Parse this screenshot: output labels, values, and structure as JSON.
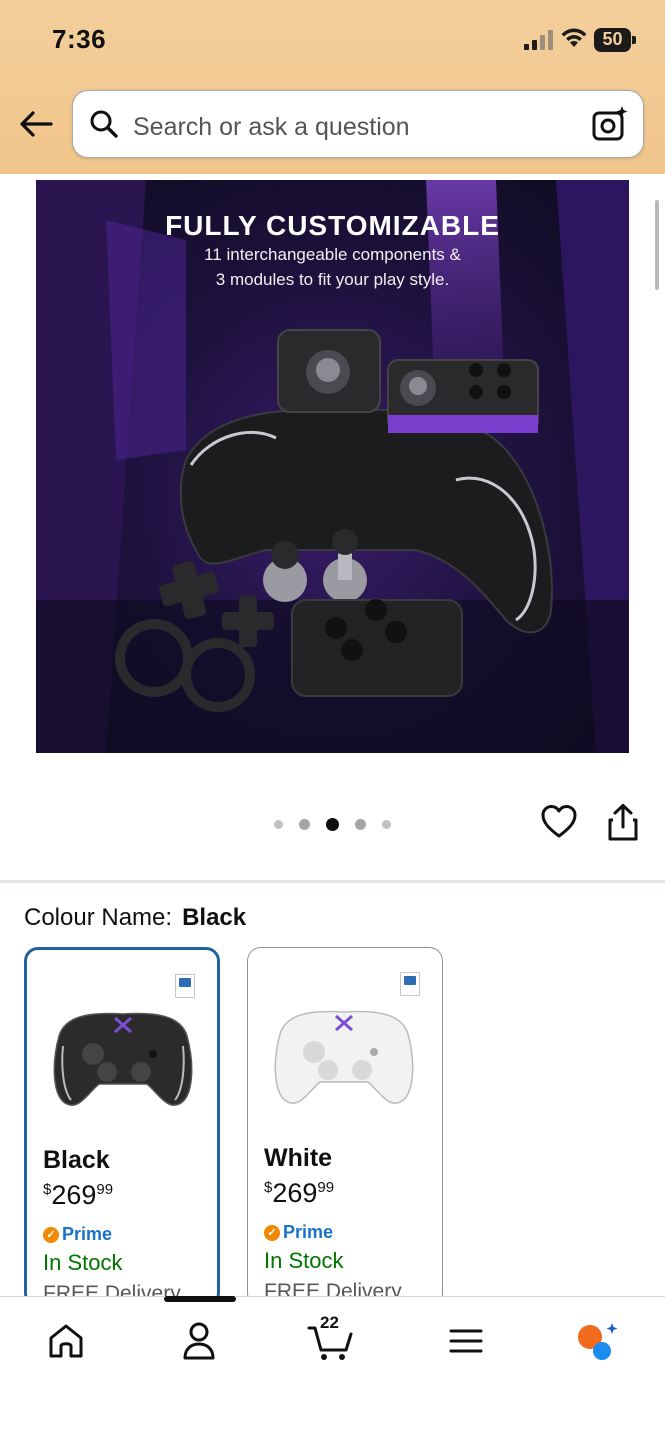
{
  "status_bar": {
    "time": "7:36",
    "battery": "50"
  },
  "search": {
    "placeholder": "Search or ask a question"
  },
  "hero": {
    "title": "FULLY CUSTOMIZABLE",
    "subtitle_line1": "11 interchangeable components &",
    "subtitle_line2": "3 modules to fit your play style.",
    "image_index": 3,
    "image_count": 5
  },
  "colour": {
    "label": "Colour Name:",
    "value": "Black"
  },
  "variants": [
    {
      "name": "Black",
      "price_symbol": "$",
      "price_whole": "269",
      "price_fraction": "99",
      "prime": "Prime",
      "stock": "In Stock",
      "delivery": "FREE Delivery",
      "color": "#2b2b2b"
    },
    {
      "name": "White",
      "price_symbol": "$",
      "price_whole": "269",
      "price_fraction": "99",
      "prime": "Prime",
      "stock": "In Stock",
      "delivery": "FREE Delivery",
      "color": "#f2f2f2"
    }
  ],
  "bottom_nav": {
    "cart_count": "22"
  },
  "colors": {
    "header_bg": "#f3cf9c",
    "selected_border": "#2162a1",
    "prime_blue": "#1a73c9",
    "stock_green": "#007600"
  }
}
